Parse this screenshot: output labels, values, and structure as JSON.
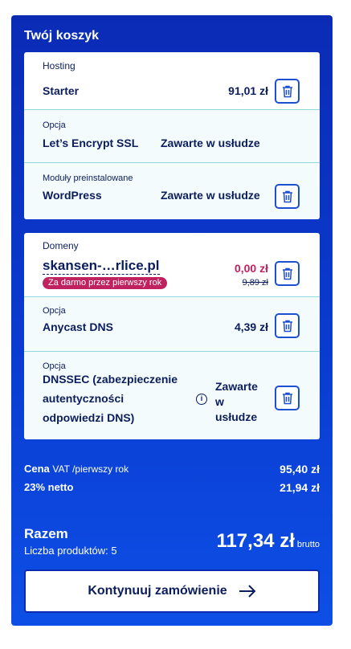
{
  "cart": {
    "title": "Twój koszyk"
  },
  "hosting": {
    "section_label": "Hosting",
    "plan_name": "Starter",
    "plan_price": "91,01 zł",
    "option": {
      "label": "Opcja",
      "name": "Let’s Encrypt SSL",
      "status": "Zawarte w usłudze"
    },
    "preinstalled": {
      "label": "Moduły preinstalowane",
      "name": "WordPress",
      "status": "Zawarte w usłudze"
    }
  },
  "domains": {
    "section_label": "Domeny",
    "domain_name": "skansen-…rlice.pl",
    "promo_badge": "Za darmo przez pierwszy rok",
    "promo_price": "0,00 zł",
    "old_price": "9,89 zł",
    "anycast": {
      "label": "Opcja",
      "name": "Anycast DNS",
      "price": "4,39 zł"
    },
    "dnssec": {
      "label": "Opcja",
      "name_line1": "DNSSEC (zabezpieczenie",
      "name_line2": "autentyczności",
      "name_line3": "odpowiedzi DNS)",
      "status_line1": "Zawarte",
      "status_line2": "w",
      "status_line3": "usłudze",
      "info_icon": "i"
    }
  },
  "summary": {
    "price_label": "Cena",
    "price_note": "VAT /pierwszy rok",
    "price_value": "95,40 zł",
    "vat_label": "23% netto",
    "vat_value": "21,94 zł",
    "total_label": "Razem",
    "count_label": "Liczba produktów: 5",
    "total_value": "117,34 zł",
    "total_suffix": "brutto"
  },
  "actions": {
    "continue_label": "Kontynuuj zamówienie"
  },
  "icons": {
    "trash": "trash-icon",
    "arrow": "arrow-right-icon",
    "info": "info-icon"
  },
  "colors": {
    "panel_blue": "#0a3bd0",
    "promo_pink": "#c0225f",
    "text_navy": "#0b1d5c",
    "row_tint": "#f3fbfc"
  }
}
